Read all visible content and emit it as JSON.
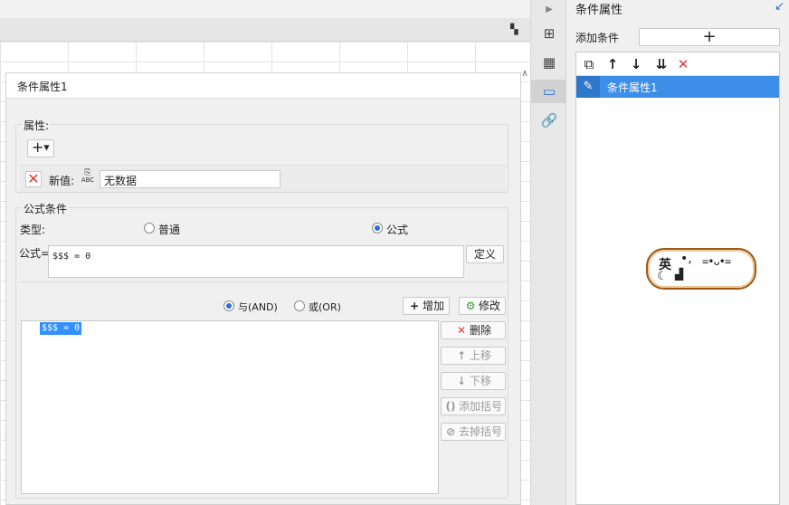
{
  "dialog": {
    "title": "条件属性1",
    "attribute_group": {
      "label": "属性:",
      "add_symbol": "+",
      "new_value_label": "新值:",
      "value_icon_text": "ABC",
      "value": "无数据"
    },
    "formula_group": {
      "label": "公式条件",
      "type_label": "类型:",
      "type_options": [
        {
          "label": "普通",
          "checked": false
        },
        {
          "label": "公式",
          "checked": true
        }
      ],
      "formula_label": "公式=",
      "formula_value": "$$$ = 0",
      "define_button": "定义",
      "logic_options": [
        {
          "label": "与(AND)",
          "checked": true
        },
        {
          "label": "或(OR)",
          "checked": false
        }
      ],
      "add_button": "增加",
      "modify_button": "修改",
      "conditions": [
        "$$$ = 0"
      ],
      "side_buttons": [
        {
          "label": "删除",
          "icon": "close-icon",
          "enabled": true
        },
        {
          "label": "上移",
          "icon": "arrow-up-icon",
          "enabled": false
        },
        {
          "label": "下移",
          "icon": "arrow-down-icon",
          "enabled": false
        },
        {
          "label": "添加括号",
          "icon": "bracket-icon",
          "enabled": false
        },
        {
          "label": "去掉括号",
          "icon": "remove-bracket-icon",
          "enabled": false
        }
      ]
    }
  },
  "right_panel": {
    "title": "条件属性",
    "add_condition_label": "添加条件",
    "add_symbol": "+",
    "list_items": [
      "条件属性1"
    ]
  },
  "ime": {
    "char": "英",
    "dots": "•,",
    "cat": "=•ᴗ•="
  },
  "colors": {
    "accent": "#3c8ee8",
    "delete_red": "#e53935",
    "selection": "#3390ff"
  }
}
